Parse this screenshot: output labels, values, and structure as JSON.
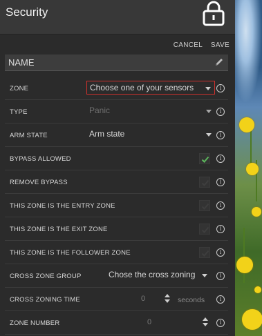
{
  "header": {
    "title": "Security",
    "lock_icon": "lock-icon"
  },
  "actions": {
    "cancel": "CANCEL",
    "save": "SAVE"
  },
  "name_bar": {
    "label": "NAME",
    "icon": "pencil-icon"
  },
  "rows": [
    {
      "label": "ZONE",
      "control": "select",
      "value": "Choose one of your sensors",
      "highlight": true
    },
    {
      "label": "TYPE",
      "control": "select",
      "value": "Panic",
      "disabled": true
    },
    {
      "label": "ARM STATE",
      "control": "select",
      "value": "Arm state"
    },
    {
      "label": "BYPASS ALLOWED",
      "control": "checkbox",
      "checked": true
    },
    {
      "label": "REMOVE BYPASS",
      "control": "checkbox",
      "checked": false
    },
    {
      "label": "THIS ZONE IS THE ENTRY ZONE",
      "control": "checkbox",
      "checked": false
    },
    {
      "label": "THIS ZONE IS THE EXIT ZONE",
      "control": "checkbox",
      "checked": false
    },
    {
      "label": "THIS ZONE IS THE FOLLOWER ZONE",
      "control": "checkbox",
      "checked": false
    },
    {
      "label": "CROSS ZONE GROUP",
      "control": "select",
      "value": "Chose the cross zoning group"
    },
    {
      "label": "CROSS ZONING TIME",
      "control": "number",
      "value": "0",
      "units": "seconds"
    },
    {
      "label": "ZONE NUMBER",
      "control": "number",
      "value": "0"
    }
  ],
  "info_glyph": "i",
  "colors": {
    "accent_red": "#d0312d",
    "check_green": "#5cb85c",
    "panel_bg": "#2b2b2b"
  }
}
